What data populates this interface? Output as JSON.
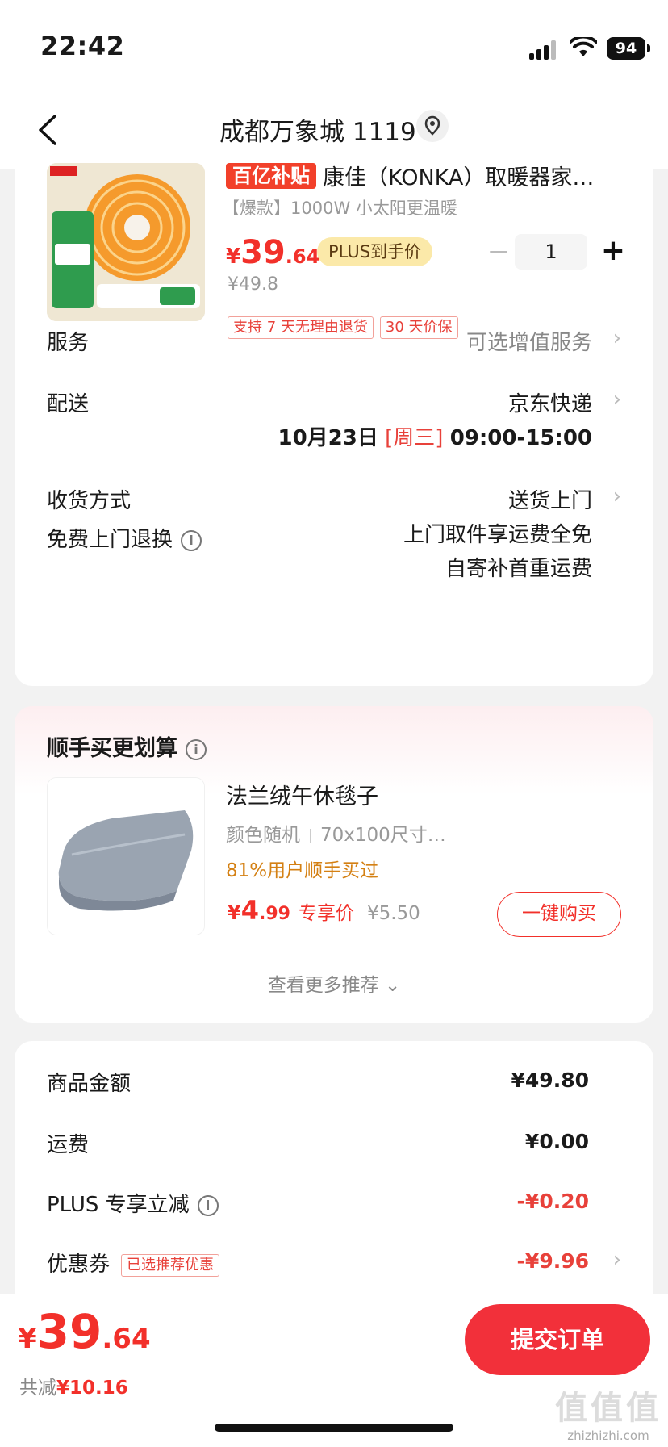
{
  "status": {
    "time": "22:42",
    "battery": "94"
  },
  "nav": {
    "title": "成都万象城 1119"
  },
  "product": {
    "subsidy_tag": "百亿补贴",
    "title": "康佳（KONKA）取暖器家…",
    "subtitle": "【爆款】1000W 小太阳更温暖",
    "price_symbol": "¥",
    "price_int": "39",
    "price_dec": ".64",
    "plus_tag": "PLUS到手价",
    "quantity": "1",
    "qty_minus": "−",
    "qty_plus": "+",
    "orig_price": "¥49.8",
    "tags": [
      "支持 7 天无理由退货",
      "30 天价保"
    ]
  },
  "rows": {
    "service_label": "服务",
    "service_value": "可选增值服务",
    "delivery_label": "配送",
    "delivery_value": "京东快递",
    "delivery_date": "10月23日",
    "delivery_weekday": "[周三]",
    "delivery_time": "09:00-15:00",
    "receive_label": "收货方式",
    "receive_value": "送货上门",
    "return_label": "免费上门退换",
    "return_line1": "上门取件享运费全免",
    "return_line2": "自寄补首重运费",
    "chevron": "›"
  },
  "recommend": {
    "title": "顺手买更划算",
    "item_name": "法兰绒午休毯子",
    "spec1": "颜色随机",
    "spec2": "70x100尺寸…",
    "bought": "81%用户顺手买过",
    "price_symbol": "¥",
    "price_int": "4",
    "price_dec": ".99",
    "exclusive": "专享价",
    "orig_price": "¥5.50",
    "buy_label": "一键购买",
    "more_label": "查看更多推荐 ⌄"
  },
  "summary": {
    "goods_label": "商品金额",
    "goods_value": "¥49.80",
    "freight_label": "运费",
    "freight_value": "¥0.00",
    "plus_label": "PLUS 专享立减",
    "plus_value": "-¥0.20",
    "coupon_label": "优惠券",
    "coupon_tag": "已选推荐优惠",
    "coupon_value": "-¥9.96"
  },
  "footer": {
    "price_symbol": "¥",
    "price_int": "39",
    "price_dec": ".64",
    "save_label": "共减",
    "save_value": "¥10.16",
    "submit_label": "提交订单",
    "watermark": "值值值",
    "watermark_url": "zhizhizhi.com"
  },
  "colors": {
    "accent": "#f2302a",
    "plus_bg": "#fbe9a9",
    "bought": "#d48013"
  },
  "icons": [
    "back-icon",
    "location-icon",
    "info-icon",
    "chevron-right-icon",
    "chevron-down-icon",
    "signal-icon",
    "wifi-icon",
    "battery-icon"
  ]
}
